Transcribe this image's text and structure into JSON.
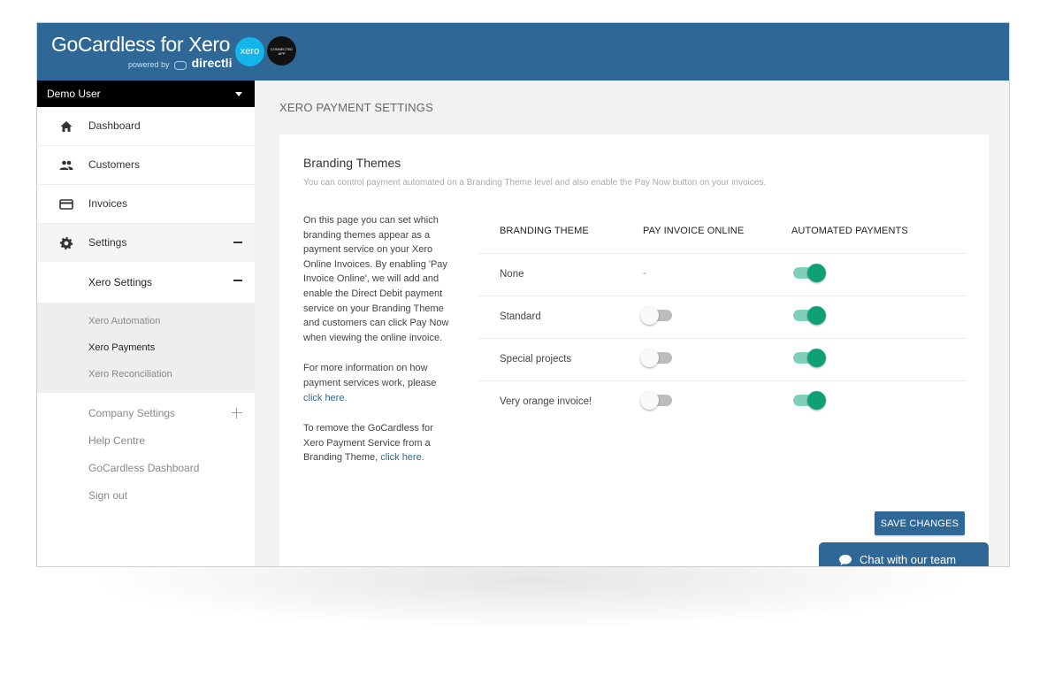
{
  "brand": {
    "name_bold": "GoCardless",
    "name_light": "for Xero",
    "powered_by": "powered by",
    "partner": "directli",
    "xero_badge": "xero",
    "connected_badge": "CONNECTED APP"
  },
  "sidebar": {
    "user": "Demo User",
    "items": [
      {
        "label": "Dashboard",
        "icon": "home-icon"
      },
      {
        "label": "Customers",
        "icon": "people-icon"
      },
      {
        "label": "Invoices",
        "icon": "card-icon"
      },
      {
        "label": "Settings",
        "icon": "gear-icon"
      }
    ],
    "xero_settings": "Xero Settings",
    "xero_sub": [
      "Xero Automation",
      "Xero Payments",
      "Xero Reconciliation"
    ],
    "other": [
      "Company Settings",
      "Help Centre",
      "GoCardless Dashboard",
      "Sign out"
    ]
  },
  "main": {
    "heading": "XERO PAYMENT SETTINGS",
    "card_title": "Branding Themes",
    "card_sub": "You can control payment automated on a Branding Theme level and also enable the Pay Now button on your invoices.",
    "info1": "On this page you can set which branding themes appear as a payment service on your Xero Online Invoices. By enabling 'Pay Invoice Online', we will add and enable the Direct Debit payment service on your Branding Theme and customers can click Pay Now when viewing the online invoice.",
    "info2_text": "For more information on how payment services work, please",
    "info2_link": "click here.",
    "info3_text": "To remove the GoCardless for Xero Payment Service from a Branding Theme,",
    "info3_link": "click here.",
    "table": {
      "headers": [
        "BRANDING THEME",
        "PAY INVOICE ONLINE",
        "AUTOMATED PAYMENTS"
      ],
      "rows": [
        {
          "name": "None",
          "pay_online": "-",
          "pay_online_on": null,
          "automated_on": true
        },
        {
          "name": "Standard",
          "pay_online": "",
          "pay_online_on": false,
          "automated_on": true
        },
        {
          "name": "Special projects",
          "pay_online": "",
          "pay_online_on": false,
          "automated_on": true
        },
        {
          "name": "Very orange invoice!",
          "pay_online": "",
          "pay_online_on": false,
          "automated_on": true
        }
      ]
    },
    "save_label": "SAVE CHANGES",
    "chat_label": "Chat with our team"
  },
  "colors": {
    "header": "#2f6896",
    "toggle_on": "#0fa176",
    "link": "#2f6896"
  }
}
